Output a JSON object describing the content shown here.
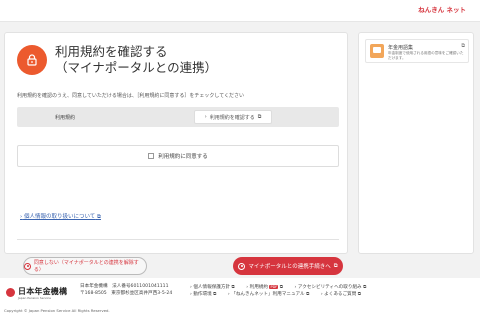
{
  "header": {
    "brand_link": "ねんきん ネット"
  },
  "main": {
    "title_line1": "利用規約を確認する",
    "title_line2": "（マイナポータルとの連携）",
    "instruction": "利用規約を確認のうえ、同意していただける場合は、［利用規約に同意する］をチェックしてください",
    "terms_row": {
      "label": "利用規約",
      "button": "利用規約を確認する"
    },
    "agree_checkbox_label": "利用規約に同意する",
    "privacy_link": "個人情報の取り扱いについて",
    "disagree_button": "同意しない（マイナポータルとの連携を解除する）",
    "agree_button": "マイナポータルとの連携手続きへ"
  },
  "side": {
    "title": "年金用語集",
    "desc": "年金制度で使用される用語の意味をご確認いただけます。"
  },
  "footer": {
    "logo": "日本年金機構",
    "logo_sub": "Japan Pension Service",
    "address_line1": "日本年金機構　法人番号6011001041111",
    "address_line2": "〒168-8505　東京都杉並区高井戸西3-5-24",
    "links_row1": [
      "個人情報保護方針",
      "利用規約",
      "アクセシビリティへの取り組み"
    ],
    "links_row2": [
      "動作環境",
      "「ねんきんネット」利用マニュアル",
      "よくあるご質問"
    ],
    "pdf_label": "PDF",
    "copyright": "Copyright © Japan Pension Service All Rights Reserved."
  },
  "colors": {
    "accent": "#d6353e",
    "orange": "#ec5a2e",
    "link": "#3a64b0"
  }
}
